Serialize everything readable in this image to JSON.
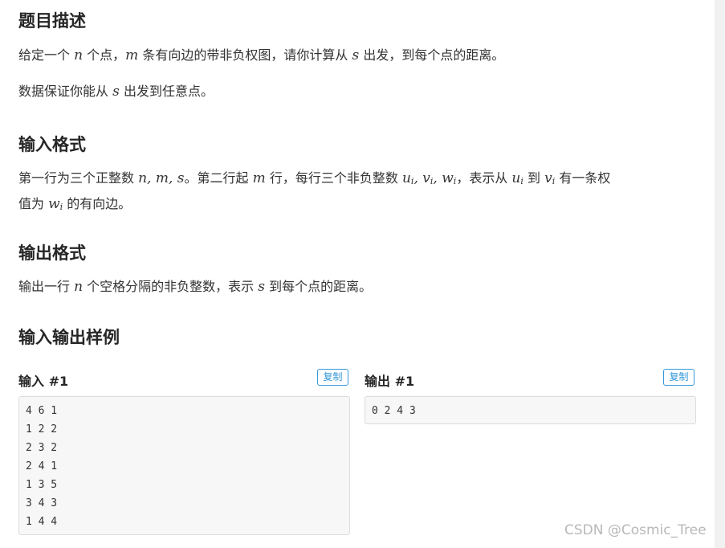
{
  "sections": {
    "description_title": "题目描述",
    "input_format_title": "输入格式",
    "output_format_title": "输出格式",
    "samples_title": "输入输出样例"
  },
  "description": {
    "p1": {
      "a": "给定一个",
      "n": "n",
      "b": "个点，",
      "m": "m",
      "c": "条有向边的带非负权图，请你计算从",
      "s": "s",
      "d": "出发，到每个点的距离。"
    },
    "p2": {
      "a": "数据保证你能从",
      "s": "s",
      "b": "出发到任意点。"
    }
  },
  "input_format": {
    "a": "第一行为三个正整数",
    "nms": "n, m, s",
    "b": "。第二行起",
    "m": "m",
    "c": "行，每行三个非负整数",
    "uvw": "u",
    "sub_i": "i",
    "comma": ", ",
    "v": "v",
    "w": "w",
    "d": "，表示从",
    "e": "到",
    "f": "有一条权",
    "g": "值为",
    "h": "的有向边。"
  },
  "output_format": {
    "a": "输出一行",
    "n": "n",
    "b": "个空格分隔的非负整数，表示",
    "s": "s",
    "c": "到每个点的距离。"
  },
  "sample": {
    "input_label": "输入 #1",
    "output_label": "输出 #1",
    "copy_label": "复制",
    "input_text": "4 6 1\n1 2 2\n2 3 2\n2 4 1\n1 3 5\n3 4 3\n1 4 4",
    "output_text": "0 2 4 3"
  },
  "watermark": "CSDN @Cosmic_Tree"
}
